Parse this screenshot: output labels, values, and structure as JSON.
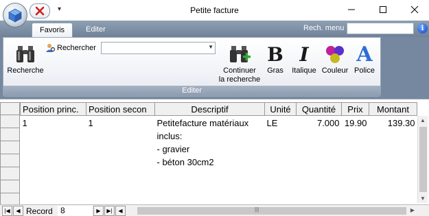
{
  "window": {
    "title": "Petite facture"
  },
  "ribbon": {
    "tabs": [
      {
        "label": "Favoris"
      },
      {
        "label": "Editer"
      }
    ],
    "search_menu_label": "Rech. menu",
    "search_menu_value": "",
    "group_label": "Editer",
    "buttons": {
      "recherche": "Recherche",
      "rechercher": "Rechercher",
      "continuer_line1": "Continuer",
      "continuer_line2": "la recherche",
      "gras": "Gras",
      "italique": "Italique",
      "couleur": "Couleur",
      "police": "Police"
    }
  },
  "grid": {
    "columns": [
      "Position princ.",
      "Position secon",
      "Descriptif",
      "Unité",
      "Quantité",
      "Prix",
      "Montant"
    ],
    "rows": [
      {
        "position_princ": "1",
        "position_secon": "1",
        "descriptif_lines": [
          "Petitefacture matériaux",
          "inclus:",
          "- gravier",
          "- béton 30cm2"
        ],
        "unite": "LE",
        "quantite": "7.000",
        "prix": "19.90",
        "montant": "139.30"
      }
    ]
  },
  "navigation": {
    "record_label": "Record",
    "record_value": "8"
  },
  "colors": {
    "ribbon_dark": "#6f8298",
    "help_icon": "#1246b8"
  }
}
